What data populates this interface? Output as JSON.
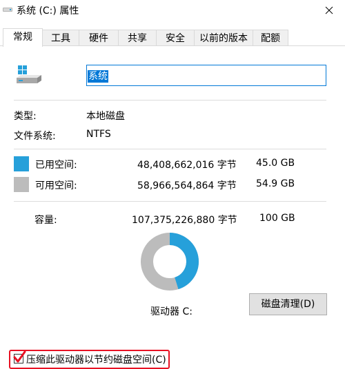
{
  "window": {
    "title": "系统 (C:) 属性"
  },
  "tabs": [
    {
      "label": "常规"
    },
    {
      "label": "工具"
    },
    {
      "label": "硬件"
    },
    {
      "label": "共享"
    },
    {
      "label": "安全"
    },
    {
      "label": "以前的版本"
    },
    {
      "label": "配额"
    }
  ],
  "drive": {
    "name_value": "系统"
  },
  "info": {
    "type_label": "类型:",
    "type_value": "本地磁盘",
    "fs_label": "文件系统:",
    "fs_value": "NTFS"
  },
  "usage": {
    "used_label": "已用空间:",
    "used_bytes": "48,408,662,016 字节",
    "used_size": "45.0 GB",
    "free_label": "可用空间:",
    "free_bytes": "58,966,564,864 字节",
    "free_size": "54.9 GB",
    "capacity_label": "容量:",
    "capacity_bytes": "107,375,226,880 字节",
    "capacity_size": "100 GB",
    "used_fraction": 0.4508,
    "used_color": "#26a0da",
    "free_color": "#bcbcbc"
  },
  "drive_label": "驱动器 C:",
  "cleanup_button": "磁盘清理(D)",
  "compress_label": "压缩此驱动器以节约磁盘空间(C)",
  "compress_checked": true
}
